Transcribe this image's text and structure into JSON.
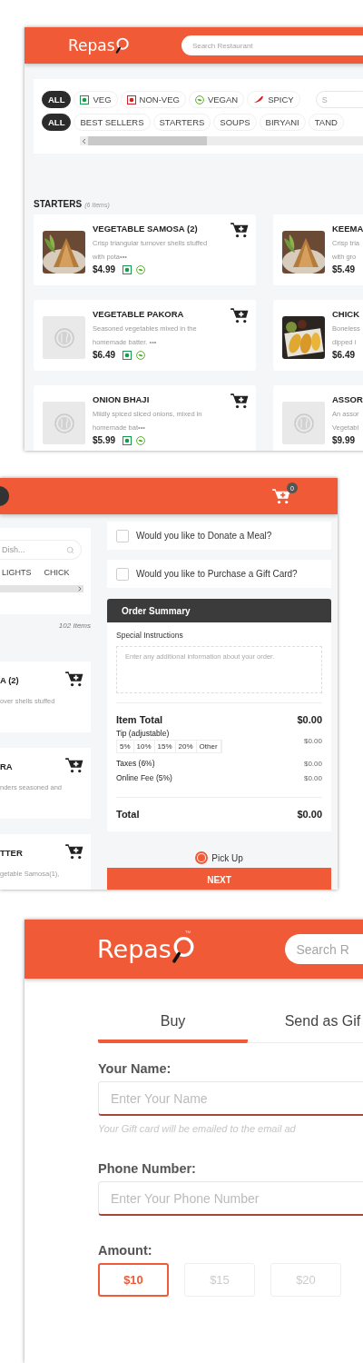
{
  "menu_screen": {
    "logo": "Repas",
    "search": {
      "placeholder": "Search Restaurant"
    },
    "diet_filters": [
      {
        "label": "ALL",
        "kind": "all",
        "selected": true
      },
      {
        "label": "VEG",
        "kind": "veg",
        "selected": false
      },
      {
        "label": "NON-VEG",
        "kind": "nonveg",
        "selected": false
      },
      {
        "label": "VEGAN",
        "kind": "vegan",
        "selected": false
      },
      {
        "label": "SPICY",
        "kind": "spicy",
        "selected": false
      }
    ],
    "filter_search": {
      "placeholder": "S"
    },
    "categories": [
      {
        "label": "ALL",
        "selected": true
      },
      {
        "label": "BEST SELLERS",
        "selected": false
      },
      {
        "label": "STARTERS",
        "selected": false
      },
      {
        "label": "SOUPS",
        "selected": false
      },
      {
        "label": "BIRYANI",
        "selected": false
      },
      {
        "label": "TAND",
        "selected": false
      }
    ],
    "section": {
      "title": "STARTERS",
      "count": "(6 Items)"
    },
    "rows": [
      {
        "left": {
          "name": "VEGETABLE SAMOSA (2)",
          "lines": [
            "Crisp triangular turnover shells stuffed",
            "with pota•••"
          ],
          "price": "$4.99",
          "kind": "picture",
          "veg": true,
          "vegan": true
        },
        "right": {
          "name": "KEEMA",
          "lines": [
            "Crisp tria",
            "with gro"
          ],
          "price": "$5.49",
          "kind": "picture"
        }
      },
      {
        "left": {
          "name": "VEGETABLE PAKORA",
          "lines": [
            "Seasoned vegetables mixed in the",
            "homemade batter. •••"
          ],
          "price": "$6.49",
          "kind": "placeholder",
          "veg": true,
          "vegan": true
        },
        "right": {
          "name": "CHICK",
          "lines": [
            "Boneless",
            "dipped i"
          ],
          "price": "$6.49",
          "kind": "picture"
        }
      },
      {
        "left": {
          "name": "ONION BHAJI",
          "lines": [
            "Mildly spiced sliced onions, mixed in",
            "homemade bat•••"
          ],
          "price": "$5.99",
          "kind": "placeholder",
          "veg": true,
          "vegan": true
        },
        "right": {
          "name": "ASSOR",
          "lines": [
            "An assor",
            "Vegetabl"
          ],
          "price": "$9.99",
          "kind": "placeholder"
        }
      }
    ]
  },
  "order_screen": {
    "cart_count": "0",
    "dish_search": {
      "placeholder": "Dish..."
    },
    "categories": [
      "LIGHTS",
      "CHICK"
    ],
    "item_count": "102 Items",
    "items": [
      {
        "name": "A (2)",
        "description": "over shells stuffed"
      },
      {
        "name": "RA",
        "description": "nders seasoned and"
      },
      {
        "name": "TTER",
        "description": "getable Samosa(1),"
      }
    ],
    "options": [
      {
        "label": "Would you like to Donate a Meal?",
        "checked": false
      },
      {
        "label": "Would you like to Purchase a Gift Card?",
        "checked": false
      }
    ],
    "summary": {
      "title": "Order Summary",
      "instructions_label": "Special Instructions",
      "instructions_placeholder": "Enter any additional information about your order.",
      "item_total": {
        "label": "Item Total",
        "value": "$0.00"
      },
      "tip": {
        "label": "Tip (adjustable)",
        "value": "$0.00",
        "choices": [
          {
            "label": "5%",
            "selected": false
          },
          {
            "label": "10%",
            "selected": false
          },
          {
            "label": "15%",
            "selected": false
          },
          {
            "label": "20%",
            "selected": false
          },
          {
            "label": "Other",
            "selected": false
          }
        ]
      },
      "fees": [
        {
          "label": "Taxes (6%)",
          "value": "$0.00"
        },
        {
          "label": "Online Fee (5%)",
          "value": "$0.00"
        }
      ],
      "total": {
        "label": "Total",
        "value": "$0.00"
      }
    },
    "pickup": {
      "label": "Pick Up",
      "selected": true
    },
    "next": "NEXT"
  },
  "gift_screen": {
    "logo": "Repas",
    "trademark": "™",
    "search": {
      "placeholder": "Search R"
    },
    "tabs": [
      {
        "label": "Buy",
        "selected": true
      },
      {
        "label": "Send as Gif",
        "selected": false
      }
    ],
    "fields": [
      {
        "label": "Your Name:",
        "placeholder": "Enter Your Name",
        "hint": "Your Gift card will be emailed to the email ad"
      },
      {
        "label": "Phone Number:",
        "placeholder": "Enter Your Phone Number"
      }
    ],
    "amount_label": "Amount:",
    "amounts": [
      {
        "label": "$10",
        "selected": true
      },
      {
        "label": "$15",
        "selected": false
      },
      {
        "label": "$20",
        "selected": false
      }
    ]
  }
}
